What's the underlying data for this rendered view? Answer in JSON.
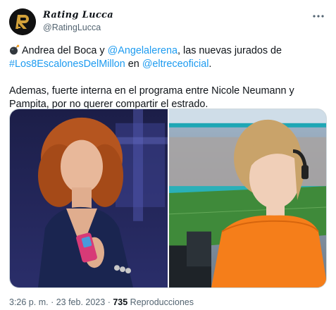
{
  "account": {
    "display_name": "Rating Lucca",
    "handle": "@RatingLucca",
    "avatar_letter": "R",
    "avatar_colors": {
      "bg": "#111111",
      "gold": "#d2a13a"
    }
  },
  "menu_icon": "more-horizontal-icon",
  "tweet": {
    "emoji": "bomb-icon",
    "line1_a": "Andrea del Boca y ",
    "mention1": "@Angelalerena",
    "line1_b": ", las nuevas jurados de ",
    "hashtag": "#Los8EscalonesDelMillon",
    "line1_c": " en ",
    "mention2": "@eltreceoficial",
    "line1_d": ".",
    "paragraph2": "Ademas, fuerte interna en el programa entre Nicole Neumann y Pampita, por no querer compartir el estrado."
  },
  "meta": {
    "time": "3:26 p. m.",
    "sep1": " · ",
    "date": "23 feb. 2023",
    "sep2": " · ",
    "views": "735",
    "views_label": " Reproducciones"
  },
  "colors": {
    "link": "#1d9bf0",
    "text": "#0f1419",
    "muted": "#536471"
  }
}
